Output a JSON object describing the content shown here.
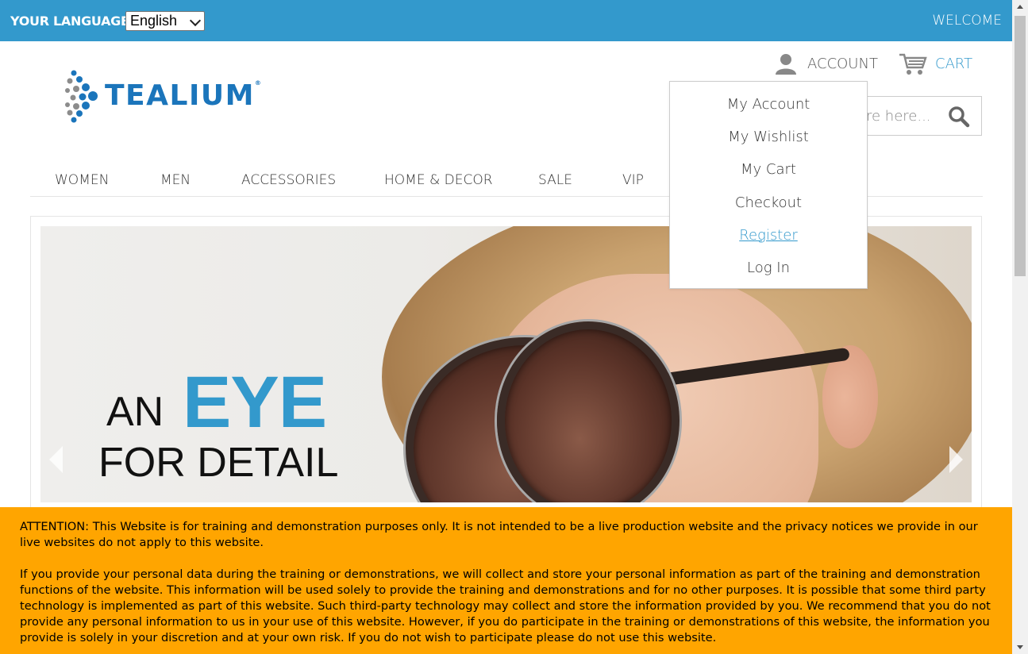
{
  "topbar": {
    "language_label": "YOUR LANGUAGE:",
    "language_selected": "English",
    "welcome": "WELCOME"
  },
  "logo": {
    "text": "TEALIUM",
    "mark": "®"
  },
  "header": {
    "account_label": "ACCOUNT",
    "cart_label": "CART",
    "search_placeholder": "re here..."
  },
  "nav": {
    "items": [
      "WOMEN",
      "MEN",
      "ACCESSORIES",
      "HOME & DECOR",
      "SALE",
      "VIP"
    ]
  },
  "account_menu": {
    "items": [
      "My Account",
      "My Wishlist",
      "My Cart",
      "Checkout",
      "Register",
      "Log In"
    ]
  },
  "banner": {
    "line1": "AN",
    "highlight": "EYE",
    "line2": "FOR DETAIL"
  },
  "notice": {
    "paragraph1": "ATTENTION: This Website is for training and demonstration purposes only. It is not intended to be a live production website and the privacy notices we provide in our live websites do not apply to this website.",
    "paragraph2": "If you provide your personal data during the training or demonstrations, we will collect and store your personal information as part of the training and demonstration functions of the website. This information will be used solely to provide the training and demonstrations and for no other purposes. It is possible that some third party technology is implemented as part of this website. Such third-party technology may collect and store the information provided by you. We recommend that you do not provide any personal information to us in your use of this website. However, if you do participate in the training or demonstrations of this website, the information you provide is solely in your discretion and at your own risk. If you do not wish to participate please do not use this website."
  },
  "colors": {
    "brand_blue": "#3399cc",
    "logo_blue": "#1b75bb",
    "notice_bg": "#ffa500"
  }
}
